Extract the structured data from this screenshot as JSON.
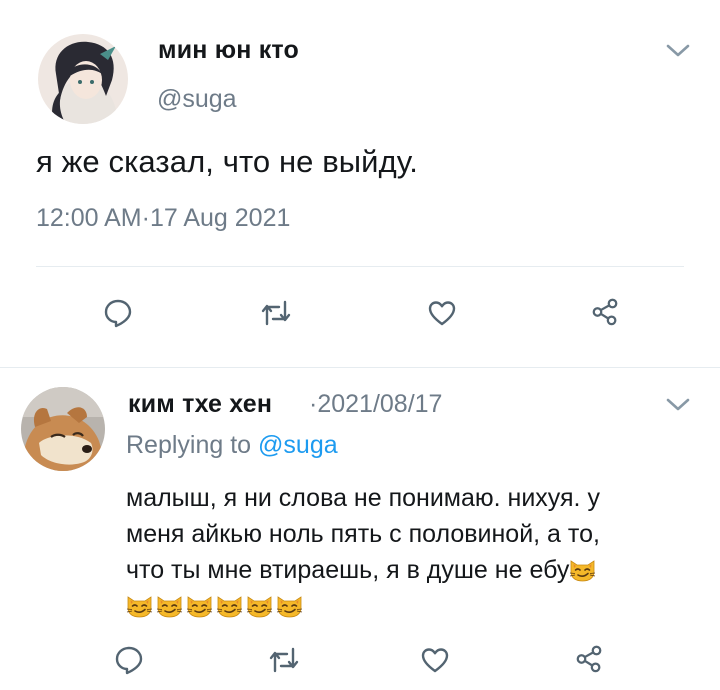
{
  "tweet": {
    "display_name": "мин юн кто",
    "handle": "@suga",
    "text": "я же сказал, что не выйду.",
    "timestamp": "12:00 AM·17 Aug 2021"
  },
  "reply": {
    "display_name": "ким тхе хен",
    "date": "·2021/08/17",
    "replying_prefix": "Replying to ",
    "replying_handle": "@suga",
    "text_lines": [
      "малыш, я ни слова не понимаю. нихуя. у",
      "меня айкью ноль пять с половиной, а то,",
      "что ты мне втираешь, я в душе не ебу"
    ],
    "emoji_count_line3": 1,
    "emoji_count_line4": 6,
    "emoji_name": "smirking-cat-face"
  },
  "icons": {
    "reply": "speech-bubble-icon",
    "retweet": "retweet-icon",
    "like": "heart-icon",
    "share": "share-icon",
    "more": "chevron-down-icon"
  },
  "colors": {
    "text": "#14171a",
    "muted": "#6e7b88",
    "accent": "#1d9bf0",
    "divider": "#e6ecf0",
    "icon": "#536471"
  }
}
